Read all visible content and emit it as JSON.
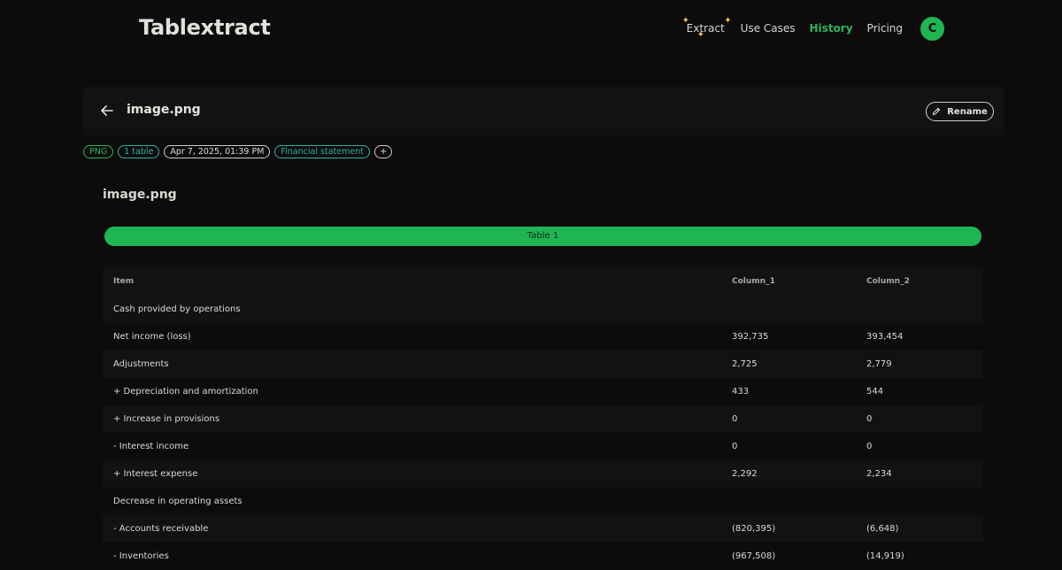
{
  "nav": {
    "brand": "Tablextract",
    "links": [
      "Extract",
      "Use Cases",
      "History",
      "Pricing"
    ],
    "avatar_initial": "C"
  },
  "file": {
    "name": "image.png",
    "rename_label": "Rename",
    "tags": [
      "PNG",
      "1 table",
      "Apr 7, 2025, 01:39 PM",
      "Financial statement",
      "+"
    ]
  },
  "document": {
    "title": "image.png",
    "table_tab": "Table 1"
  },
  "table": {
    "columns": [
      "Item",
      "Column_1",
      "Column_2"
    ],
    "rows": [
      [
        "Cash provided by operations",
        "",
        ""
      ],
      [
        "Net income (loss)",
        "392,735",
        "393,454"
      ],
      [
        "Adjustments",
        "2,725",
        "2,779"
      ],
      [
        "+ Depreciation and amortization",
        "433",
        "544"
      ],
      [
        "+ Increase in provisions",
        "0",
        "0"
      ],
      [
        "- Interest income",
        "0",
        "0"
      ],
      [
        "+ Interest expense",
        "2,292",
        "2,234"
      ],
      [
        "Decrease in operating assets",
        "",
        ""
      ],
      [
        "- Accounts receivable",
        "(820,395)",
        "(6,648)"
      ],
      [
        "- Inventories",
        "(967,508)",
        "(14,919)"
      ]
    ]
  },
  "colors": {
    "accent": "#1fb552",
    "teal": "#2bb3a6",
    "background": "#0e0c0b"
  }
}
